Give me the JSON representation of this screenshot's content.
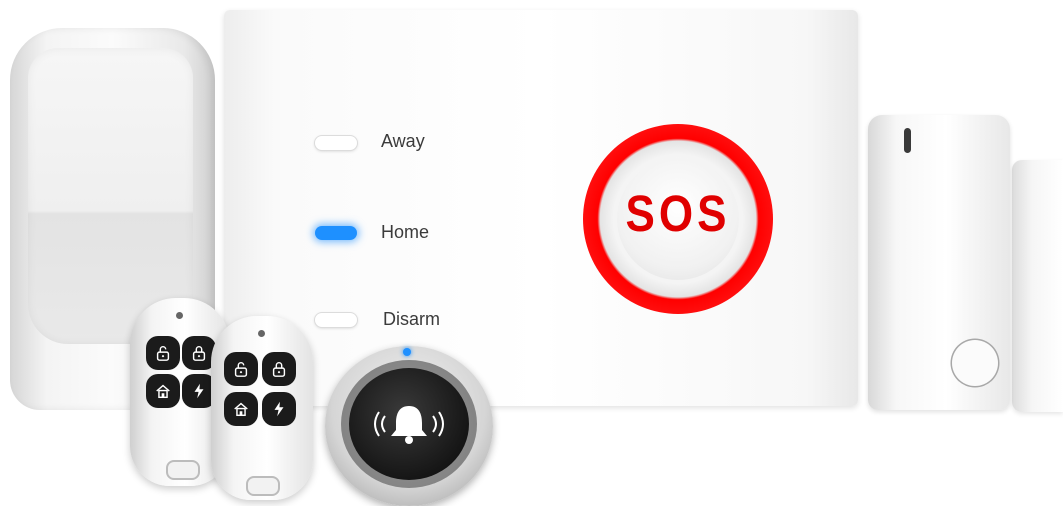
{
  "panel": {
    "modes": [
      {
        "label": "Away",
        "led_state": "off"
      },
      {
        "label": "Home",
        "led_state": "on"
      },
      {
        "label": "Disarm",
        "led_state": "off"
      }
    ],
    "sos_label": "SOS"
  },
  "colors": {
    "sos_red": "#e00000",
    "led_blue": "#1e90ff",
    "device_white": "#ffffff",
    "button_black": "#1b1b1b"
  },
  "icons": {
    "remote_buttons": [
      "unlock-icon",
      "lock-icon",
      "home-icon",
      "lightning-icon"
    ],
    "doorbell": "bell-icon"
  }
}
